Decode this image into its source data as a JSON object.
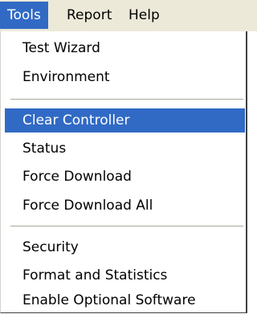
{
  "menubar": {
    "items": [
      {
        "label": "Tools",
        "active": true
      },
      {
        "label": "Report",
        "active": false
      },
      {
        "label": "Help",
        "active": false
      }
    ]
  },
  "dropdown": {
    "groups": [
      [
        {
          "label": "Test Wizard"
        },
        {
          "label": "Environment"
        }
      ],
      [
        {
          "label": "Clear Controller",
          "highlighted": true
        },
        {
          "label": "Status"
        },
        {
          "label": "Force Download"
        },
        {
          "label": "Force Download All"
        }
      ],
      [
        {
          "label": "Security"
        },
        {
          "label": "Format and Statistics"
        },
        {
          "label": "Enable Optional Software"
        }
      ]
    ]
  },
  "colors": {
    "highlight": "#316ac5",
    "highlight_text": "#ffffff",
    "menubar_bg": "#ece9d8",
    "menu_bg": "#ffffff"
  }
}
